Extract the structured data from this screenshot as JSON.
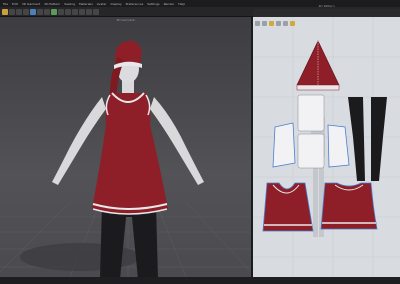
{
  "menu": {
    "items": [
      "File",
      "Edit",
      "3D Garment",
      "2D Pattern",
      "Sewing",
      "Materials",
      "Avatar",
      "Display",
      "Preferences",
      "Settings",
      "Render",
      "Help"
    ]
  },
  "viewport3d": {
    "title": "3D Garment"
  },
  "viewport2d": {
    "title": "2D Pattern"
  },
  "status": {
    "left": "",
    "right": ""
  },
  "colors": {
    "garment_red": "#8e1f28",
    "trim_white": "#e8e8ea",
    "pants_black": "#1b1b1d",
    "avatar_white": "#d9d9db",
    "pattern_bg": "#d8dbe0",
    "selection_blue": "#4a7fd0"
  },
  "icons": [
    "arrow-icon",
    "pan-icon",
    "edit-point-icon",
    "segment-icon",
    "layer-icon",
    "folder-icon"
  ]
}
